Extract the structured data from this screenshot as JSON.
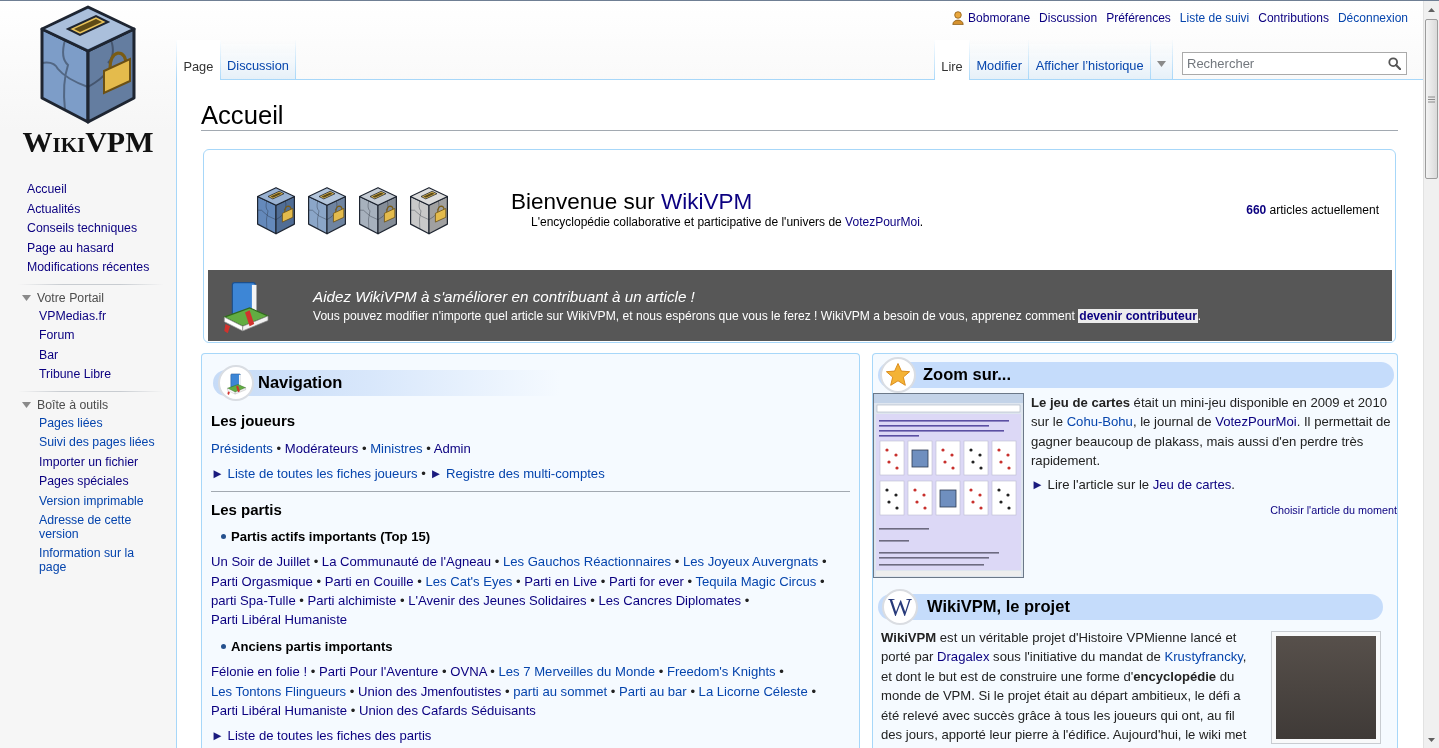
{
  "logo": {
    "text": "WikiVPM"
  },
  "sidebar": {
    "navigation": [
      {
        "label": "Accueil",
        "visited": true
      },
      {
        "label": "Actualités",
        "visited": true
      },
      {
        "label": "Conseils techniques",
        "visited": true
      },
      {
        "label": "Page au hasard",
        "visited": true
      },
      {
        "label": "Modifications récentes",
        "visited": true
      }
    ],
    "portals": [
      {
        "title": "Votre Portail",
        "expanded": true,
        "items": [
          {
            "label": "VPMedias.fr",
            "visited": true
          },
          {
            "label": "Forum",
            "visited": true
          },
          {
            "label": "Bar",
            "visited": true
          },
          {
            "label": "Tribune Libre",
            "visited": true
          }
        ]
      },
      {
        "title": "Boîte à outils",
        "expanded": true,
        "items": [
          {
            "label": "Pages liées",
            "visited": false
          },
          {
            "label": "Suivi des pages liées",
            "visited": false
          },
          {
            "label": "Importer un fichier",
            "visited": true
          },
          {
            "label": "Pages spéciales",
            "visited": true
          },
          {
            "label": "Version imprimable",
            "visited": false
          },
          {
            "label": "Adresse de cette version",
            "visited": false
          },
          {
            "label": "Information sur la page",
            "visited": false
          }
        ]
      }
    ]
  },
  "personal_links": [
    {
      "label": "Bobmorane",
      "kind": "user",
      "visited": true
    },
    {
      "label": "Discussion",
      "kind": "link",
      "visited": true
    },
    {
      "label": "Préférences",
      "kind": "link",
      "visited": true
    },
    {
      "label": "Liste de suivi",
      "kind": "link",
      "visited": false
    },
    {
      "label": "Contributions",
      "kind": "link",
      "visited": true
    },
    {
      "label": "Déconnexion",
      "kind": "link",
      "visited": false
    }
  ],
  "tabs": {
    "namespaces": [
      {
        "label": "Page",
        "selected": true
      },
      {
        "label": "Discussion",
        "selected": false
      }
    ],
    "views": [
      {
        "label": "Lire",
        "selected": true
      },
      {
        "label": "Modifier",
        "selected": false
      },
      {
        "label": "Afficher l’historique",
        "selected": false
      }
    ]
  },
  "search": {
    "placeholder": "Rechercher"
  },
  "page_title": "Accueil",
  "welcome": {
    "ballot_boxes": [
      {
        "color": "#6489bb"
      },
      {
        "color": "#8ba6c8"
      },
      {
        "color": "#a7b1bd"
      },
      {
        "color": "#c9c9c9"
      }
    ],
    "heading": [
      {
        "kind": "text",
        "text": "Bienvenue sur "
      },
      {
        "kind": "link",
        "text": "WikiVPM",
        "visited": true
      }
    ],
    "subtitle": [
      {
        "kind": "text",
        "text": "L'encyclopédie collaborative et participative de l'univers de "
      },
      {
        "kind": "link",
        "text": "VotezPourMoi",
        "visited": true
      },
      {
        "kind": "text",
        "text": "."
      }
    ],
    "article_count": [
      {
        "kind": "strong_link",
        "text": "660",
        "visited": true
      },
      {
        "kind": "text",
        "text": " articles actuellement"
      }
    ]
  },
  "banner": {
    "title": "Aidez WikiVPM à s'améliorer en contribuant à un article !",
    "text": [
      {
        "kind": "text",
        "text": "Vous pouvez modifier n'importe quel article sur WikiVPM, et nous espérons que vous le ferez ! WikiVPM a besoin de vous, apprenez comment "
      },
      {
        "kind": "strong_link",
        "text": "devenir contributeur",
        "visited": true
      },
      {
        "kind": "text",
        "text": "."
      }
    ]
  },
  "navigation": {
    "title": "Navigation",
    "separator": "•",
    "players": {
      "heading": "Les joueurs",
      "links": [
        {
          "text": "Présidents",
          "visited": false
        },
        {
          "text": "Modérateurs",
          "visited": true
        },
        {
          "text": "Ministres",
          "visited": false
        },
        {
          "text": "Admin",
          "visited": true
        }
      ],
      "more": [
        {
          "marker": "►",
          "text": "Liste de toutes les fiches joueurs",
          "visited": false
        },
        {
          "marker": "►",
          "text": "Registre des multi-comptes",
          "visited": false
        }
      ]
    },
    "parties": {
      "heading": "Les partis",
      "groups": [
        {
          "title": "Partis actifs importants (Top 15)",
          "links": [
            {
              "text": "Un Soir de Juillet",
              "visited": true
            },
            {
              "text": "La Communauté de l'Agneau",
              "visited": true
            },
            {
              "text": "Les Gauchos Réactionnaires",
              "visited": false
            },
            {
              "text": "Les Joyeux Auvergnats",
              "visited": false
            },
            {
              "text": "Parti Orgasmique",
              "visited": true
            },
            {
              "text": "Parti en Couille",
              "visited": true
            },
            {
              "text": "Les Cat's Eyes",
              "visited": false
            },
            {
              "text": "Parti en Live",
              "visited": true
            },
            {
              "text": "Parti for ever",
              "visited": true
            },
            {
              "text": "Tequila Magic Circus",
              "visited": false
            },
            {
              "text": "parti Spa-Tulle",
              "visited": true
            },
            {
              "text": "Parti alchimiste",
              "visited": true
            },
            {
              "text": "L'Avenir des Jeunes Solidaires",
              "visited": true
            },
            {
              "text": "Les Cancres Diplomates",
              "visited": true
            },
            {
              "text": "Parti Libéral Humaniste",
              "visited": true
            }
          ]
        },
        {
          "title": "Anciens partis importants",
          "links": [
            {
              "text": "Félonie en folie !",
              "visited": true
            },
            {
              "text": "Parti Pour l'Aventure",
              "visited": true
            },
            {
              "text": "OVNA",
              "visited": true
            },
            {
              "text": "Les 7 Merveilles du Monde",
              "visited": false
            },
            {
              "text": "Freedom's Knights",
              "visited": false
            },
            {
              "text": "Les Tontons Flingueurs",
              "visited": false
            },
            {
              "text": "Union des Jmenfoutistes",
              "visited": true
            },
            {
              "text": "parti au sommet",
              "visited": false
            },
            {
              "text": "Parti au bar",
              "visited": false
            },
            {
              "text": "La Licorne Céleste",
              "visited": false
            },
            {
              "text": "Parti Libéral Humaniste",
              "visited": true
            },
            {
              "text": "Union des Cafards Séduisants",
              "visited": true
            }
          ]
        }
      ],
      "more": [
        {
          "marker": "►",
          "text": "Liste de toutes les fiches des partis",
          "visited": true
        }
      ]
    }
  },
  "featured": {
    "title": "Zoom sur...",
    "paragraph": [
      {
        "kind": "text",
        "text": "**Le jeu de cartes** était un mini-jeu disponible en 2009 et 2010 sur le "
      },
      {
        "kind": "link",
        "text": "Cohu-Bohu",
        "visited": false
      },
      {
        "kind": "text",
        "text": ", le journal de "
      },
      {
        "kind": "link",
        "text": "VotezPourMoi",
        "visited": true
      },
      {
        "kind": "text",
        "text": ". Il permettait de gagner beaucoup de plakass, mais aussi d'en perdre très rapidement."
      }
    ],
    "read_more": {
      "marker": "►",
      "parts": [
        {
          "kind": "text",
          "text": "Lire l'article sur le "
        },
        {
          "kind": "link",
          "text": "Jeu de cartes",
          "visited": true
        },
        {
          "kind": "text",
          "text": "."
        }
      ]
    },
    "choose_link": {
      "text": "Choisir l'article du moment",
      "visited": true
    }
  },
  "project": {
    "badge_letter": "W",
    "title": "WikiVPM, le projet",
    "paragraph": [
      {
        "kind": "text",
        "text": "**WikiVPM** est un véritable projet d'Histoire VPMienne lancé et porté par "
      },
      {
        "kind": "link",
        "text": "Dragalex",
        "visited": true
      },
      {
        "kind": "text",
        "text": " sous l'initiative du mandat de "
      },
      {
        "kind": "link",
        "text": "Krustyfrancky",
        "visited": false
      },
      {
        "kind": "text",
        "text": ", et dont le but est de construire une forme d'**encyclopédie** du monde de VPM. Si le projet était au départ ambitieux, le défi a été relevé avec succès grâce à tous les joueurs qui ont, au fil des jours, apporté leur pierre à l'édifice. Aujourd'hui, le wiki met"
      }
    ]
  }
}
